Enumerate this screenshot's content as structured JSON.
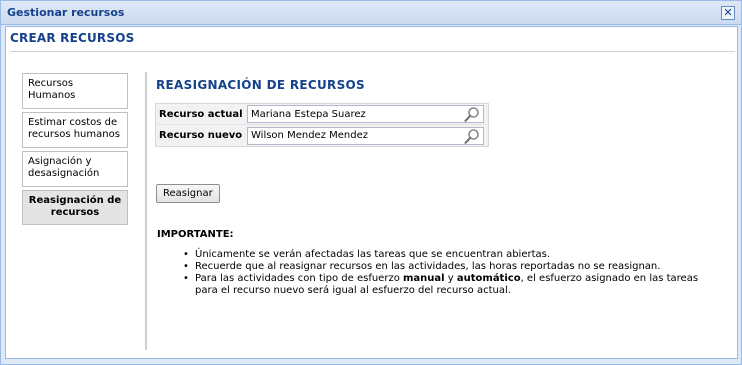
{
  "window": {
    "title": "Gestionar recursos",
    "close_icon": "close-icon"
  },
  "page": {
    "title": "CREAR RECURSOS"
  },
  "sidebar": {
    "items": [
      {
        "label": "Recursos Humanos",
        "active": false
      },
      {
        "label": "Estimar costos de recursos humanos",
        "active": false
      },
      {
        "label": "Asignación y desasignación",
        "active": false
      },
      {
        "label": "Reasignación de recursos",
        "active": true
      }
    ]
  },
  "section": {
    "title": "REASIGNACIÓN DE RECURSOS"
  },
  "form": {
    "current_label": "Recurso actual",
    "current_value": "Mariana Estepa Suarez",
    "new_label": "Recurso nuevo",
    "new_value": "Wilson Mendez Mendez",
    "search_icon": "search-icon"
  },
  "actions": {
    "reassign_label": "Reasignar"
  },
  "notes": {
    "heading": "IMPORTANTE:",
    "item1": "Únicamente se verán afectadas las tareas que se encuentran abiertas.",
    "item2": "Recuerde que al reasignar recursos en las actividades, las horas reportadas no se reasignan.",
    "item3_pre": "Para las actividades con tipo de esfuerzo ",
    "item3_bold1": "manual",
    "item3_mid": " y ",
    "item3_bold2": "automático",
    "item3_post": ", el esfuerzo asignado en las tareas para el recurso nuevo será igual al esfuerzo del recurso actual."
  },
  "colors": {
    "title_blue": "#15428b",
    "border_blue": "#99bbe8"
  }
}
